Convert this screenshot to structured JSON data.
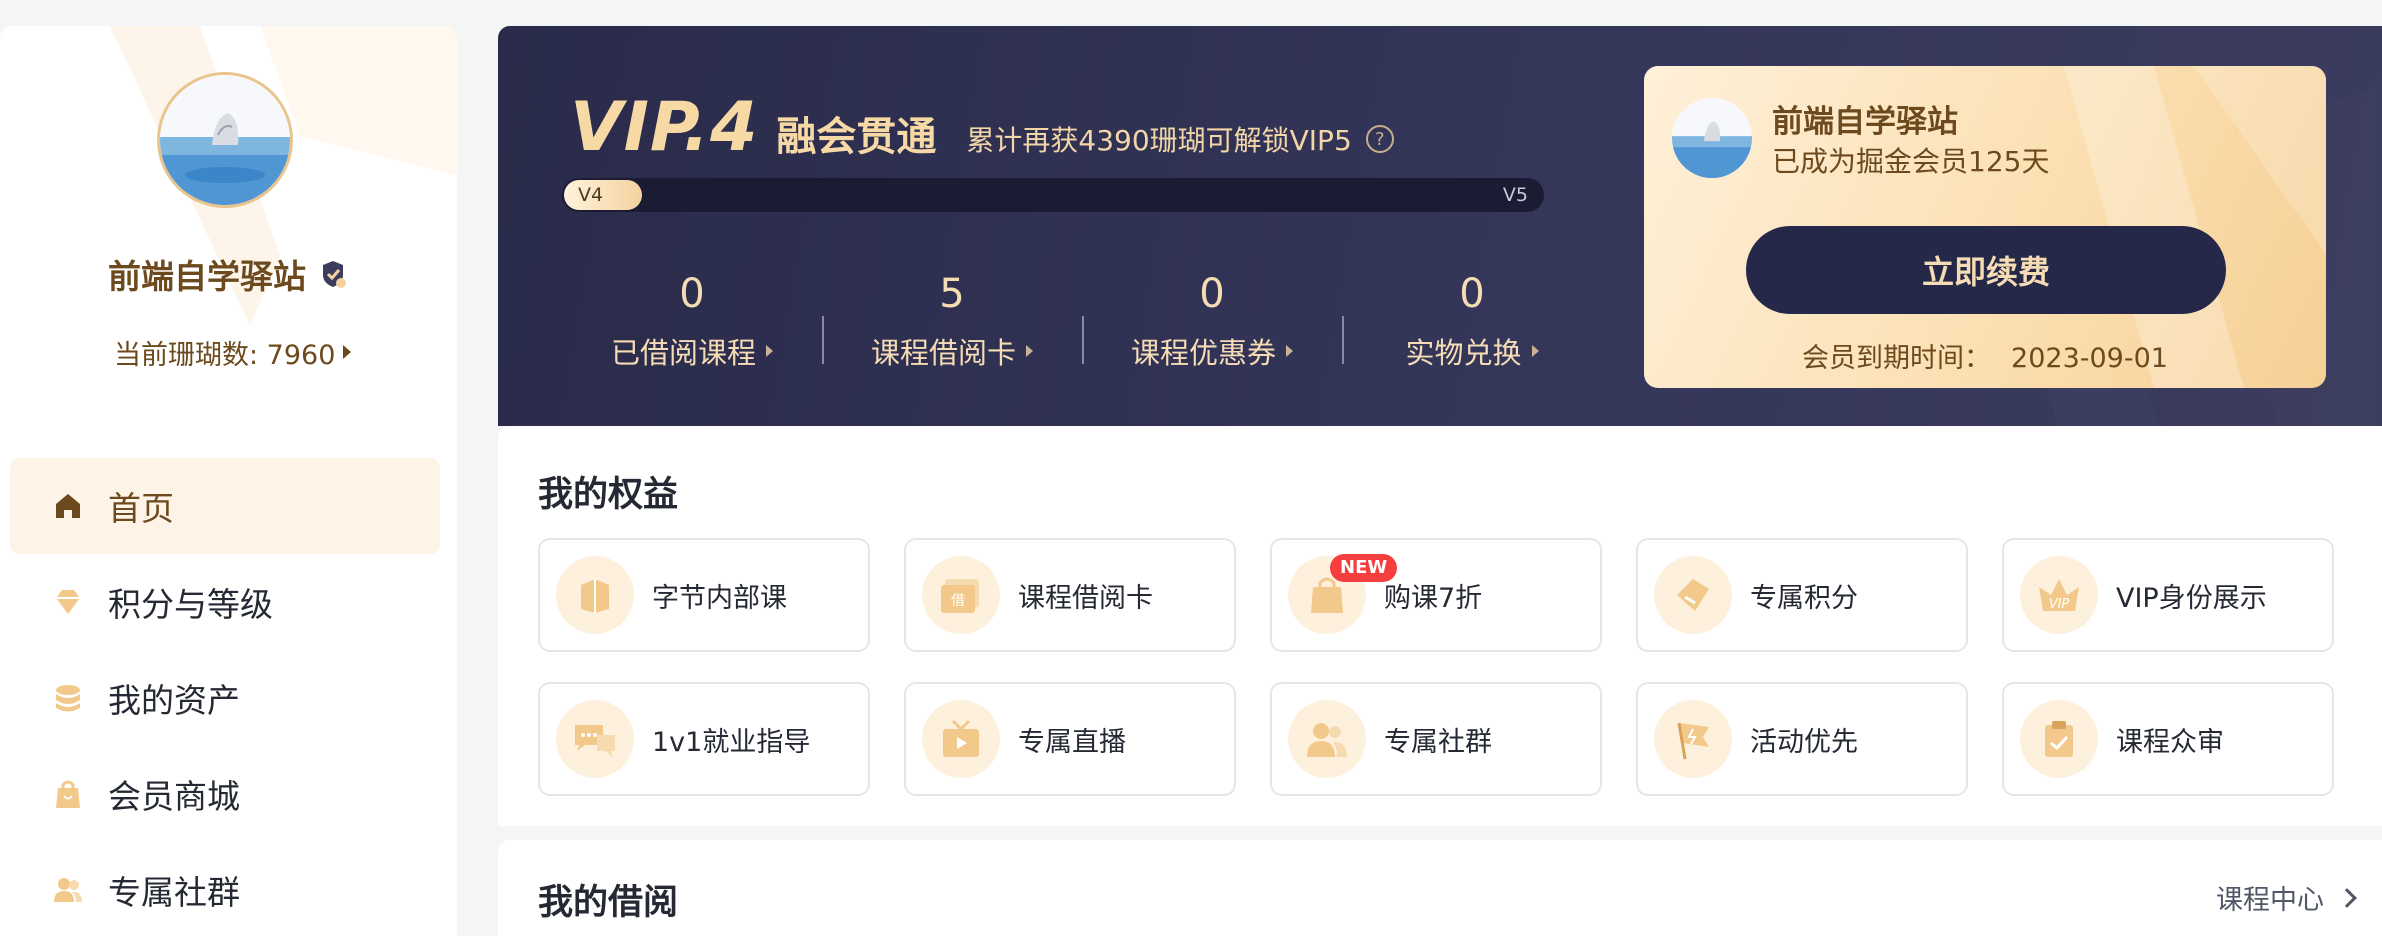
{
  "profile": {
    "username": "前端自学驿站",
    "points_label": "当前珊瑚数: 7960"
  },
  "nav": [
    {
      "label": "首页",
      "icon": "home-icon",
      "active": true
    },
    {
      "label": "积分与等级",
      "icon": "diamond-icon",
      "active": false
    },
    {
      "label": "我的资产",
      "icon": "coins-icon",
      "active": false
    },
    {
      "label": "会员商城",
      "icon": "shopping-bag-icon",
      "active": false
    },
    {
      "label": "专属社群",
      "icon": "users-icon",
      "active": false
    }
  ],
  "vip": {
    "level": "VIP.4",
    "name": "融会贯通",
    "tip": "累计再获4390珊瑚可解锁VIP5",
    "progress_start": "V4",
    "progress_end": "V5",
    "progress_fraction": 0.08
  },
  "stats": [
    {
      "value": "0",
      "label": "已借阅课程"
    },
    {
      "value": "5",
      "label": "课程借阅卡"
    },
    {
      "value": "0",
      "label": "课程优惠券"
    },
    {
      "value": "0",
      "label": "实物兑换"
    }
  ],
  "member_card": {
    "name": "前端自学驿站",
    "days": "已成为掘金会员125天",
    "renew_label": "立即续费",
    "expire_label": "会员到期时间：",
    "expire_date": "2023-09-01"
  },
  "benefits": {
    "title": "我的权益",
    "items": [
      {
        "label": "字节内部课",
        "icon": "book-icon"
      },
      {
        "label": "课程借阅卡",
        "icon": "borrow-card-icon"
      },
      {
        "label": "购课7折",
        "icon": "shopping-bag-icon",
        "badge": "NEW"
      },
      {
        "label": "专属积分",
        "icon": "points-icon"
      },
      {
        "label": "VIP身份展示",
        "icon": "crown-icon"
      },
      {
        "label": "1v1就业指导",
        "icon": "chat-icon"
      },
      {
        "label": "专属直播",
        "icon": "tv-icon"
      },
      {
        "label": "专属社群",
        "icon": "users-icon"
      },
      {
        "label": "活动优先",
        "icon": "flag-icon"
      },
      {
        "label": "课程众审",
        "icon": "clipboard-icon"
      }
    ]
  },
  "borrow": {
    "title": "我的借阅",
    "link_label": "课程中心"
  },
  "colors": {
    "gold_text": "#6c4a1d",
    "banner_bg": "#2a2b4a",
    "accent_light": "#f5dcb4",
    "badge_red": "#f53f3f"
  }
}
